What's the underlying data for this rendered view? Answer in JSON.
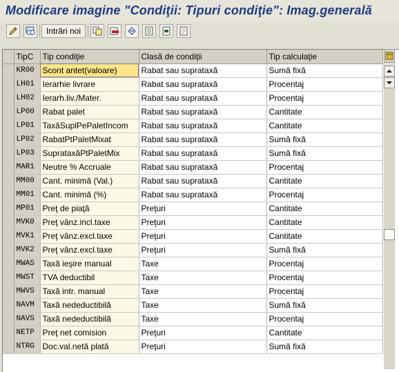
{
  "window": {
    "title": "Modificare imagine \"Condiţii: Tipuri condiţie\": Imag.generală"
  },
  "toolbar": {
    "button_text": "Intrări noi",
    "icons": [
      "edit-pencil-icon",
      "display-glasses-icon",
      "copy-icon",
      "delete-icon",
      "undo-icon",
      "select-all-icon",
      "select-block-icon",
      "deselect-icon"
    ]
  },
  "table": {
    "columns": [
      "TipC",
      "Tip condiţie",
      "Clasă de condiţii",
      "Tip calculaţie"
    ],
    "rows": [
      {
        "key": "KR00",
        "name": "Scont antet(valoare)",
        "cls": "Rabat sau suprataxă",
        "calc": "Sumă fixă"
      },
      {
        "key": "LH01",
        "name": "Ierarhie livrare",
        "cls": "Rabat sau suprataxă",
        "calc": "Procentaj"
      },
      {
        "key": "LH02",
        "name": "Ierarh.liv./Mater.",
        "cls": "Rabat sau suprataxă",
        "calc": "Procentaj"
      },
      {
        "key": "LP00",
        "name": "Rabat palet",
        "cls": "Rabat sau suprataxă",
        "calc": "Cantitate"
      },
      {
        "key": "LP01",
        "name": "TaxăSuplPePaletIncom",
        "cls": "Rabat sau suprataxă",
        "calc": "Cantitate"
      },
      {
        "key": "LP02",
        "name": "RabatPtPaletMixat",
        "cls": "Rabat sau suprataxă",
        "calc": "Sumă fixă"
      },
      {
        "key": "LP03",
        "name": "SuprataxăPtPaletMix",
        "cls": "Rabat sau suprataxă",
        "calc": "Sumă fixă"
      },
      {
        "key": "MAR1",
        "name": "Neutre % Accruale",
        "cls": "Rabat sau suprataxă",
        "calc": "Procentaj"
      },
      {
        "key": "MM00",
        "name": "Cant. minimă (Val.)",
        "cls": "Rabat sau suprataxă",
        "calc": "Cantitate"
      },
      {
        "key": "MM01",
        "name": "Cant. minimă (%)",
        "cls": "Rabat sau suprataxă",
        "calc": "Procentaj"
      },
      {
        "key": "MP01",
        "name": "Preţ de piaţă",
        "cls": "Preţuri",
        "calc": "Cantitate"
      },
      {
        "key": "MVK0",
        "name": "Preţ vânz.incl.taxe",
        "cls": "Preţuri",
        "calc": "Cantitate"
      },
      {
        "key": "MVK1",
        "name": "Preţ vânz.excl.taxe",
        "cls": "Preţuri",
        "calc": "Cantitate"
      },
      {
        "key": "MVK2",
        "name": "Preţ vânz.excl.taxe",
        "cls": "Preţuri",
        "calc": "Sumă fixă"
      },
      {
        "key": "MWAS",
        "name": "Taxă ieşire manual",
        "cls": "Taxe",
        "calc": "Procentaj"
      },
      {
        "key": "MWST",
        "name": "TVA deductibil",
        "cls": "Taxe",
        "calc": "Procentaj"
      },
      {
        "key": "MWVS",
        "name": "Taxă intr. manual",
        "cls": "Taxe",
        "calc": "Procentaj"
      },
      {
        "key": "NAVM",
        "name": "Taxă nedeductibilă",
        "cls": "Taxe",
        "calc": "Sumă fixă"
      },
      {
        "key": "NAVS",
        "name": "Taxă nedeductibilă",
        "cls": "Taxe",
        "calc": "Procentaj"
      },
      {
        "key": "NETP",
        "name": "Preţ net comision",
        "cls": "Preţuri",
        "calc": "Cantitate"
      },
      {
        "key": "NTRG",
        "name": "Doc.val.netă plată",
        "cls": "Preţuri",
        "calc": "Sumă fixă"
      }
    ]
  },
  "scrollbar": {
    "icons": [
      "scroll-up-icon",
      "scroll-down-icon",
      "table-settings-icon"
    ],
    "thumb_position_fraction": 0.52
  },
  "colors": {
    "title": "#1f3b82",
    "focus_cell": "#fce589",
    "key_column": "#fbf9e6"
  }
}
